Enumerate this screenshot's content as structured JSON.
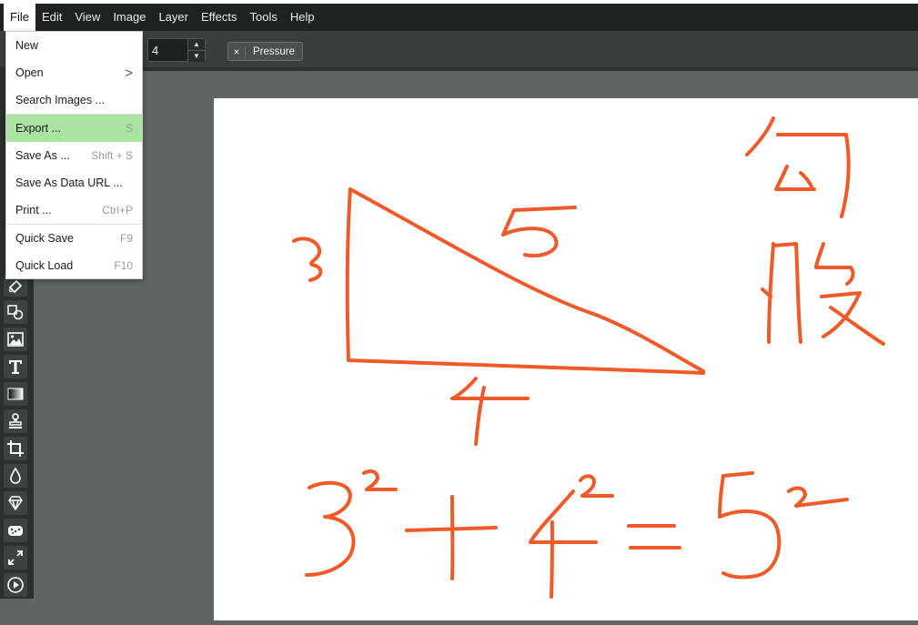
{
  "menubar": {
    "items": [
      "File",
      "Edit",
      "View",
      "Image",
      "Layer",
      "Effects",
      "Tools",
      "Help"
    ]
  },
  "toolbar": {
    "brush_size_value": "4",
    "pressure_label": "Pressure",
    "pressure_remove_glyph": "×"
  },
  "file_menu": {
    "items": [
      {
        "label": "New",
        "shortcut": ""
      },
      {
        "label": "Open",
        "shortcut": "",
        "submenu": true
      },
      {
        "label": "Search Images ...",
        "shortcut": ""
      },
      {
        "label": "Export ...",
        "shortcut": "S",
        "highlighted": true
      },
      {
        "label": "Save As ...",
        "shortcut": "Shift + S"
      },
      {
        "label": "Save As Data URL ...",
        "shortcut": ""
      },
      {
        "label": "Print ...",
        "shortcut": "Ctrl+P"
      },
      {
        "label": "Quick Save",
        "shortcut": "F9"
      },
      {
        "label": "Quick Load",
        "shortcut": "F10"
      }
    ],
    "submenu_glyph": ">"
  },
  "tools": [
    "eraser-icon",
    "shapes-icon",
    "image-icon",
    "text-icon",
    "gradient-icon",
    "stamp-icon",
    "crop-icon",
    "blur-drop-icon",
    "sharpen-icon",
    "sponge-icon",
    "resize-icon",
    "play-icon"
  ],
  "colors": {
    "menubar_bg": "#1f2222",
    "toolbar_bg": "#3a3e3e",
    "workspace_bg": "#5f6563",
    "highlight": "#a9e5a1",
    "ink": "#f05a28"
  }
}
